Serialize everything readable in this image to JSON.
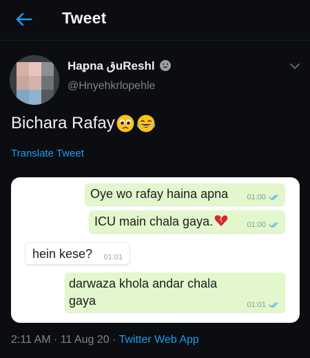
{
  "header": {
    "title": "Tweet",
    "back_icon": "back-arrow-icon",
    "accent": "#1d9bf0"
  },
  "author": {
    "display_name": "Haᵱna قuReshl",
    "name_emoji_icon": "grinning-face-icon",
    "handle": "@Hnyehkrlopehle",
    "avatar": "blurred-avatar"
  },
  "tweet": {
    "text": "Bichara Rafay",
    "emoji_icons": [
      "pleading-face-icon",
      "tears-of-joy-icon"
    ],
    "translate_label": "Translate Tweet"
  },
  "chat": {
    "messages": [
      {
        "direction": "out",
        "text": "Oye wo rafay haina apna",
        "time": "01:00",
        "status": "read"
      },
      {
        "direction": "out",
        "text": "ICU main chala gaya.",
        "emoji_icon": "broken-heart-icon",
        "time": "01:00",
        "status": "read"
      },
      {
        "direction": "in",
        "text": "hein kese?",
        "time": "01:01"
      },
      {
        "direction": "out",
        "text": "darwaza khola andar chala",
        "text_line2": "gaya",
        "time": "01:01",
        "status": "read"
      }
    ],
    "outgoing_color": "#e2f7cb",
    "tick_color": "#4fb6ec"
  },
  "footer": {
    "time": "2:11 AM",
    "sep1": "·",
    "date": "11 Aug 20",
    "sep2": "·",
    "source": "Twitter Web App"
  }
}
